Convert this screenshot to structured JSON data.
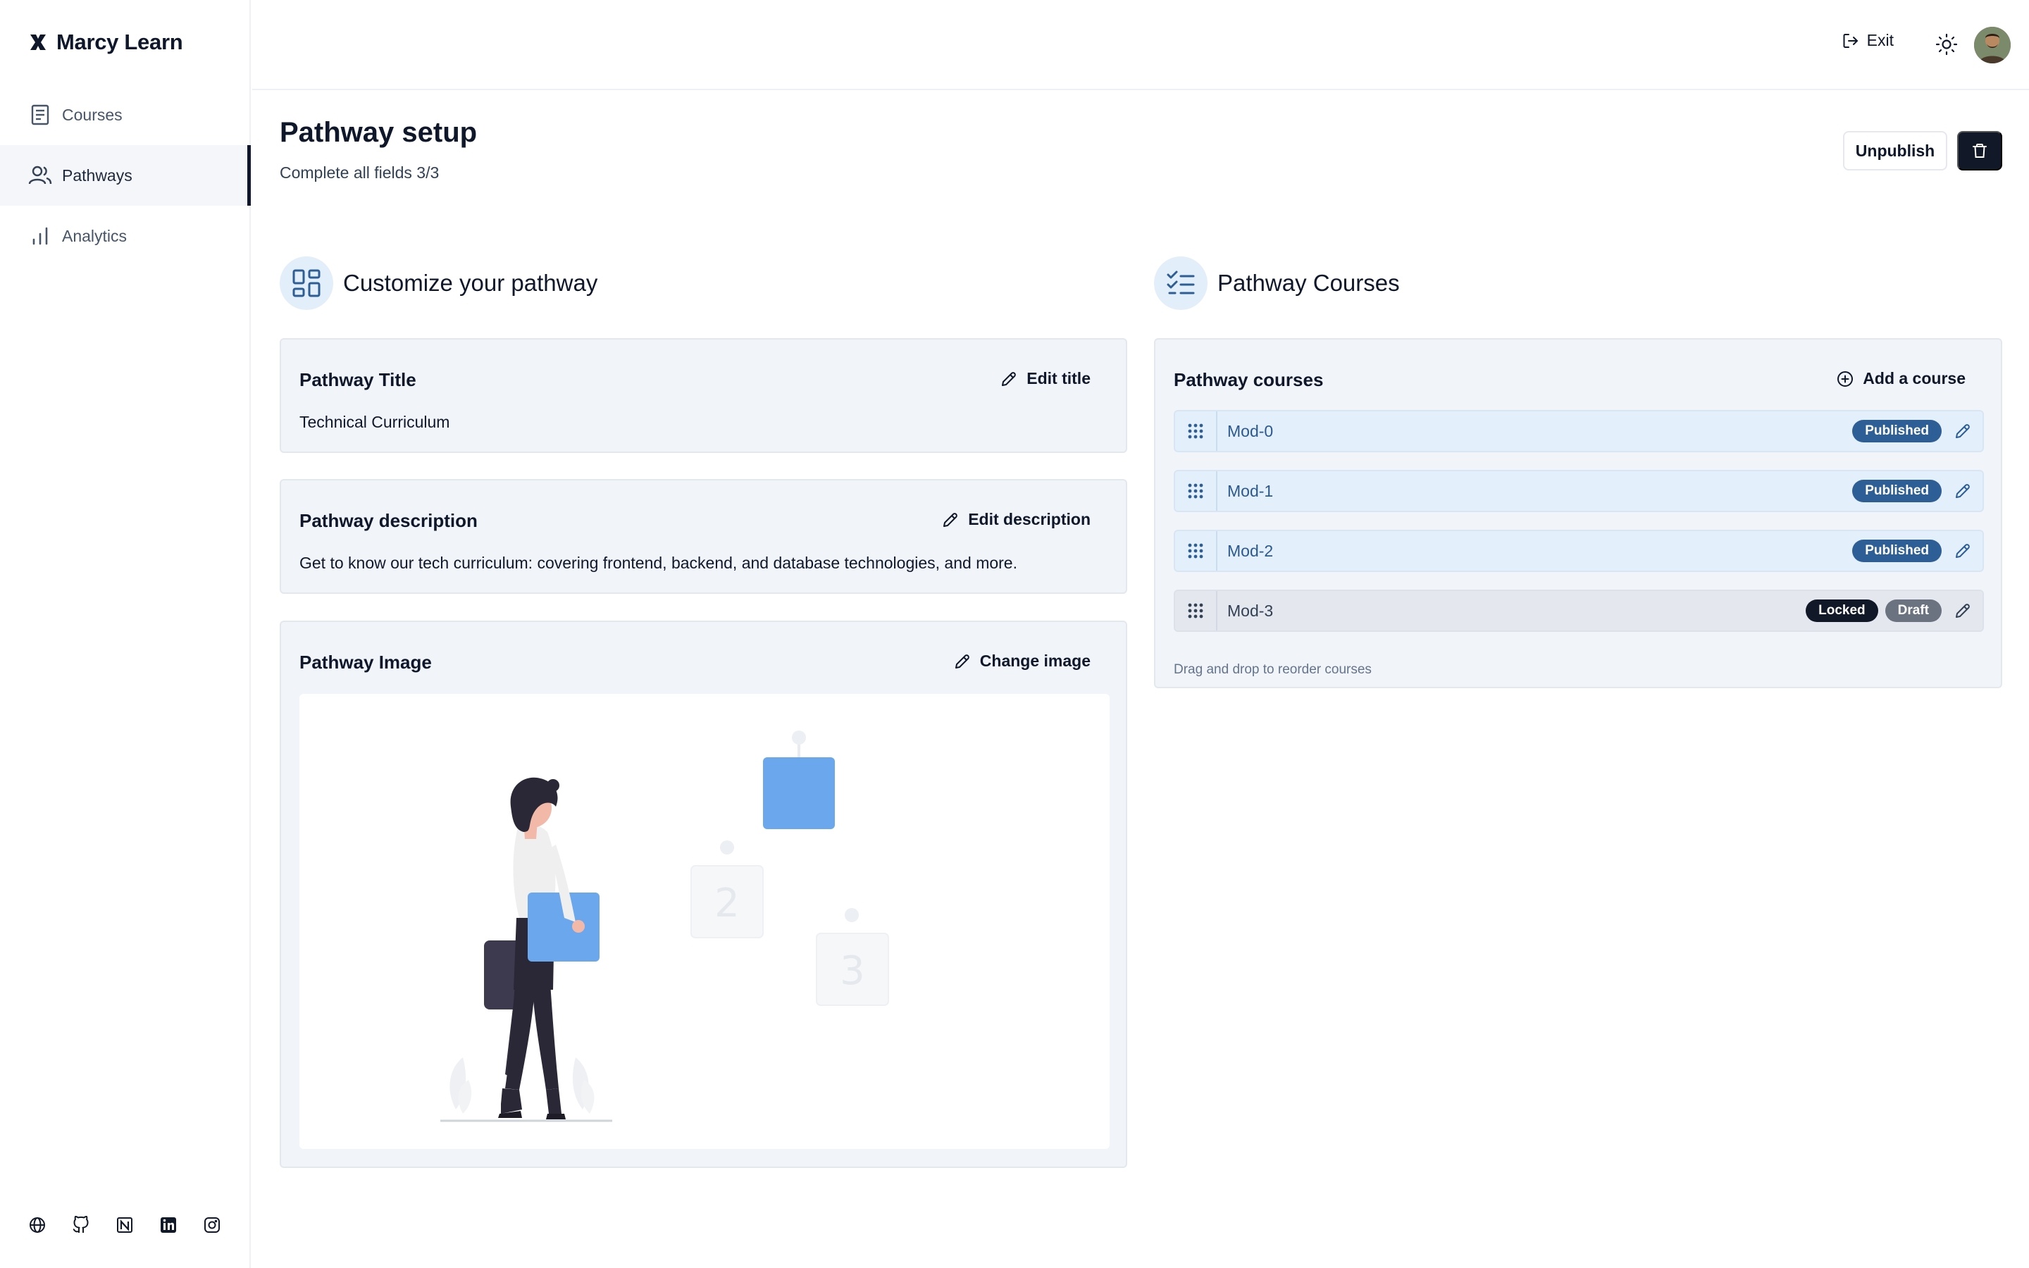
{
  "app": {
    "brand": "Marcy Learn"
  },
  "sidebar": {
    "items": [
      {
        "label": "Courses",
        "icon": "document-icon",
        "active": false
      },
      {
        "label": "Pathways",
        "icon": "users-icon",
        "active": true
      },
      {
        "label": "Analytics",
        "icon": "bar-chart-icon",
        "active": false
      }
    ],
    "social_icons": [
      "globe-icon",
      "github-icon",
      "notion-icon",
      "linkedin-icon",
      "instagram-icon"
    ]
  },
  "topbar": {
    "exit_label": "Exit"
  },
  "header": {
    "title": "Pathway setup",
    "subtitle": "Complete all fields 3/3",
    "unpublish_label": "Unpublish"
  },
  "customize": {
    "heading": "Customize your pathway",
    "title_card": {
      "label": "Pathway Title",
      "action": "Edit title",
      "value": "Technical Curriculum"
    },
    "description_card": {
      "label": "Pathway description",
      "action": "Edit description",
      "value": "Get to know our tech curriculum: covering frontend, backend, and database technologies, and more."
    },
    "image_card": {
      "label": "Pathway Image",
      "action": "Change image"
    }
  },
  "courses": {
    "heading": "Pathway Courses",
    "card_label": "Pathway courses",
    "add_label": "Add a course",
    "items": [
      {
        "name": "Mod-0",
        "badges": [
          "Published"
        ]
      },
      {
        "name": "Mod-1",
        "badges": [
          "Published"
        ]
      },
      {
        "name": "Mod-2",
        "badges": [
          "Published"
        ]
      },
      {
        "name": "Mod-3",
        "badges": [
          "Locked",
          "Draft"
        ]
      }
    ],
    "hint": "Drag and drop to reorder courses"
  },
  "colors": {
    "accent": "#2d5f96",
    "dark": "#111827",
    "card_bg": "#f1f5f9",
    "illustration_blue": "#6aa7ec"
  }
}
